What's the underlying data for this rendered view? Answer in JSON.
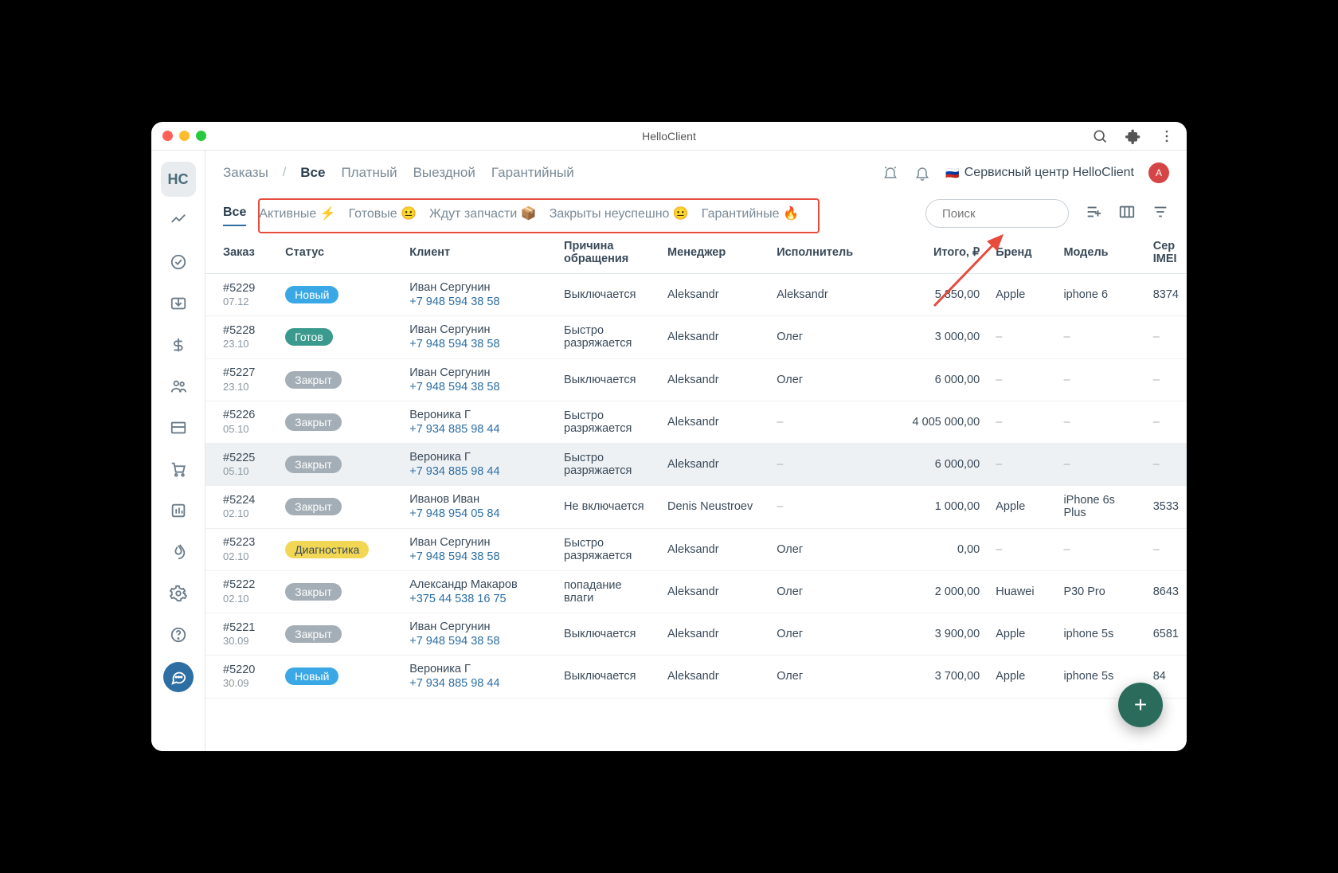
{
  "titlebar": {
    "title": "HelloClient"
  },
  "sidebar": {
    "logo": "HC"
  },
  "breadcrumb": {
    "root": "Заказы",
    "tabs": [
      "Все",
      "Платный",
      "Выездной",
      "Гарантийный"
    ],
    "active": "Все"
  },
  "topright": {
    "center_label": "Сервисный центр HelloClient",
    "flag": "🇷🇺",
    "avatar_letter": "A"
  },
  "filters": {
    "all": "Все",
    "items": [
      "Активные ⚡",
      "Готовые 😐",
      "Ждут запчасти 📦",
      "Закрыты неуспешно 😐",
      "Гарантийные 🔥"
    ]
  },
  "search": {
    "placeholder": "Поиск"
  },
  "columns": {
    "order": "Заказ",
    "status": "Статус",
    "client": "Клиент",
    "reason": "Причина обращения",
    "manager": "Менеджер",
    "assignee": "Исполнитель",
    "total": "Итого, ₽",
    "brand": "Бренд",
    "model": "Модель",
    "serial": "Сер IMEI"
  },
  "rows": [
    {
      "id": "#5229",
      "date": "07.12",
      "status": "Новый",
      "status_cls": "st-new",
      "client_name": "Иван Сергунин",
      "client_phone": "+7 948 594 38 58",
      "reason": "Выключается",
      "manager": "Aleksandr",
      "assignee": "Aleksandr",
      "total": "5 850,00",
      "brand": "Apple",
      "model": "iphone 6",
      "serial": "8374"
    },
    {
      "id": "#5228",
      "date": "23.10",
      "status": "Готов",
      "status_cls": "st-ready",
      "client_name": "Иван Сергунин",
      "client_phone": "+7 948 594 38 58",
      "reason": "Быстро разряжается",
      "manager": "Aleksandr",
      "assignee": "Олег",
      "total": "3 000,00",
      "brand": "–",
      "model": "–",
      "serial": "–"
    },
    {
      "id": "#5227",
      "date": "23.10",
      "status": "Закрыт",
      "status_cls": "st-closed",
      "client_name": "Иван Сергунин",
      "client_phone": "+7 948 594 38 58",
      "reason": "Выключается",
      "manager": "Aleksandr",
      "assignee": "Олег",
      "total": "6 000,00",
      "brand": "–",
      "model": "–",
      "serial": "–"
    },
    {
      "id": "#5226",
      "date": "05.10",
      "status": "Закрыт",
      "status_cls": "st-closed",
      "client_name": "Вероника Г",
      "client_phone": "+7 934 885 98 44",
      "reason": "Быстро разряжается",
      "manager": "Aleksandr",
      "assignee": "–",
      "total": "4 005 000,00",
      "brand": "–",
      "model": "–",
      "serial": "–"
    },
    {
      "id": "#5225",
      "date": "05.10",
      "status": "Закрыт",
      "status_cls": "st-closed",
      "client_name": "Вероника Г",
      "client_phone": "+7 934 885 98 44",
      "reason": "Быстро разряжается",
      "manager": "Aleksandr",
      "assignee": "–",
      "total": "6 000,00",
      "brand": "–",
      "model": "–",
      "serial": "–",
      "hl": true
    },
    {
      "id": "#5224",
      "date": "02.10",
      "status": "Закрыт",
      "status_cls": "st-closed",
      "client_name": "Иванов Иван",
      "client_phone": "+7 948 954 05 84",
      "reason": "Не включается",
      "manager": "Denis Neustroev",
      "assignee": "–",
      "total": "1 000,00",
      "brand": "Apple",
      "model": "iPhone 6s Plus",
      "serial": "3533"
    },
    {
      "id": "#5223",
      "date": "02.10",
      "status": "Диагностика",
      "status_cls": "st-diag",
      "client_name": "Иван Сергунин",
      "client_phone": "+7 948 594 38 58",
      "reason": "Быстро разряжается",
      "manager": "Aleksandr",
      "assignee": "Олег",
      "total": "0,00",
      "brand": "–",
      "model": "–",
      "serial": "–"
    },
    {
      "id": "#5222",
      "date": "02.10",
      "status": "Закрыт",
      "status_cls": "st-closed",
      "client_name": "Александр Макаров",
      "client_phone": "+375 44 538 16 75",
      "reason": "попадание влаги",
      "manager": "Aleksandr",
      "assignee": "Олег",
      "total": "2 000,00",
      "brand": "Huawei",
      "model": "P30 Pro",
      "serial": "8643"
    },
    {
      "id": "#5221",
      "date": "30.09",
      "status": "Закрыт",
      "status_cls": "st-closed",
      "client_name": "Иван Сергунин",
      "client_phone": "+7 948 594 38 58",
      "reason": "Выключается",
      "manager": "Aleksandr",
      "assignee": "Олег",
      "total": "3 900,00",
      "brand": "Apple",
      "model": "iphone 5s",
      "serial": "6581"
    },
    {
      "id": "#5220",
      "date": "30.09",
      "status": "Новый",
      "status_cls": "st-new",
      "client_name": "Вероника Г",
      "client_phone": "+7 934 885 98 44",
      "reason": "Выключается",
      "manager": "Aleksandr",
      "assignee": "Олег",
      "total": "3 700,00",
      "brand": "Apple",
      "model": "iphone 5s",
      "serial": "84"
    }
  ]
}
